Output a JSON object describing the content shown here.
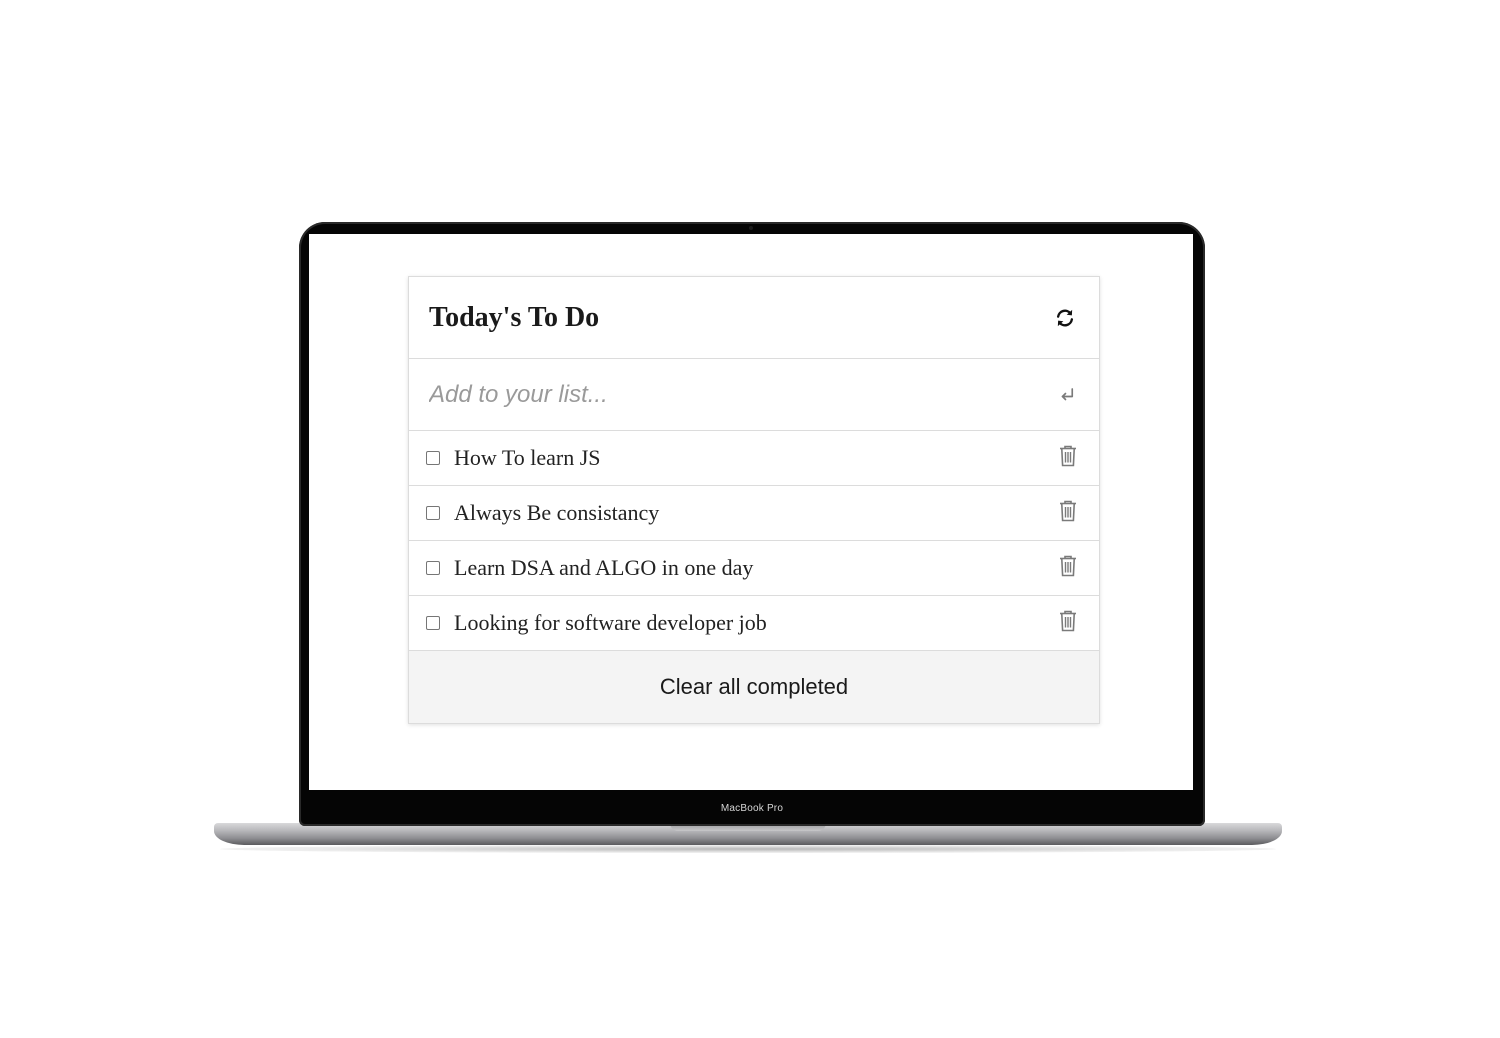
{
  "device": {
    "brand_label": "MacBook Pro"
  },
  "app": {
    "title": "Today's To Do",
    "refresh_icon": "refresh-icon",
    "add_input": {
      "placeholder": "Add to your list...",
      "value": "",
      "submit_icon": "enter-icon"
    },
    "items": [
      {
        "text": "How To learn JS",
        "checked": false,
        "delete_icon": "trash-icon"
      },
      {
        "text": "Always Be consistancy",
        "checked": false,
        "delete_icon": "trash-icon"
      },
      {
        "text": "Learn DSA and ALGO in one day",
        "checked": false,
        "delete_icon": "trash-icon"
      },
      {
        "text": "Looking for software developer job",
        "checked": false,
        "delete_icon": "trash-icon"
      }
    ],
    "clear_label": "Clear all completed"
  },
  "colors": {
    "border": "#dcdcdc",
    "footer_bg": "#f4f4f4",
    "icon_gray": "#7a7a7a",
    "bezel": "#050505"
  }
}
